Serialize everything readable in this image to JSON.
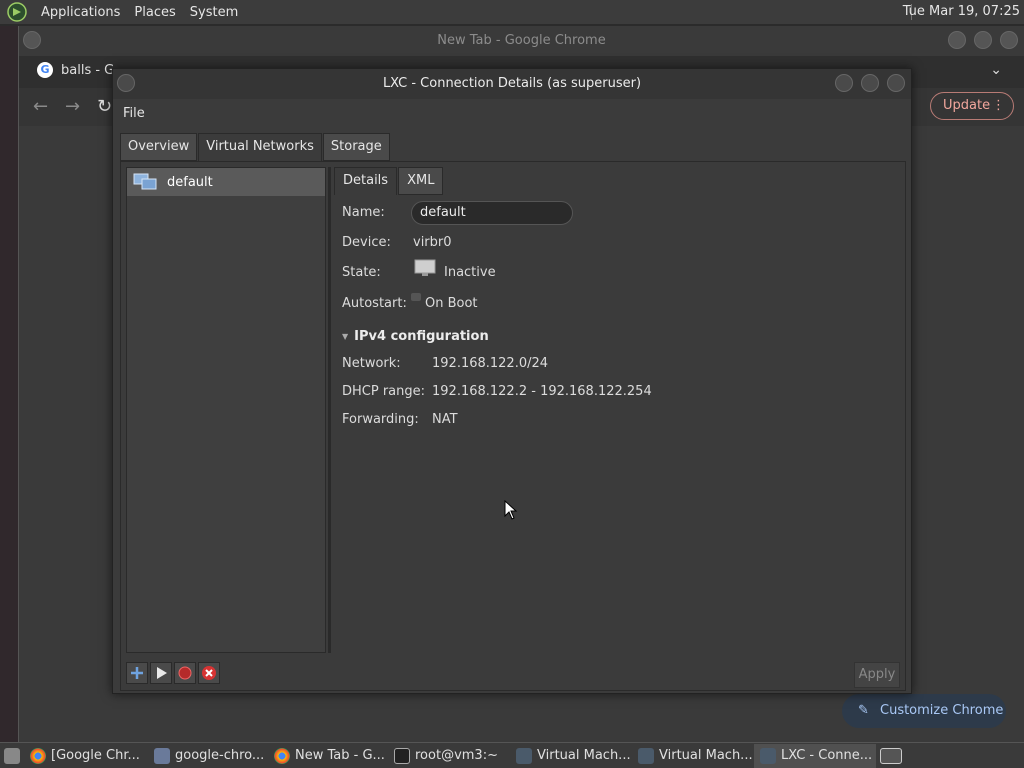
{
  "top_panel": {
    "menus": [
      "Applications",
      "Places",
      "System"
    ],
    "clock": "Tue Mar 19, 07:25"
  },
  "chrome": {
    "title": "New Tab - Google Chrome",
    "tab_label": "balls - G",
    "update_label": "Update",
    "customize_label": "Customize Chrome"
  },
  "dialog": {
    "title": "LXC - Connection Details (as superuser)",
    "menu_file": "File",
    "tabs": [
      "Overview",
      "Virtual Networks",
      "Storage"
    ],
    "active_tab": "Virtual Networks",
    "networks": [
      {
        "name": "default"
      }
    ],
    "subtabs": [
      "Details",
      "XML"
    ],
    "labels": {
      "name": "Name:",
      "device": "Device:",
      "state": "State:",
      "autostart": "Autostart:",
      "network": "Network:",
      "dhcp": "DHCP range:",
      "forwarding": "Forwarding:"
    },
    "values": {
      "name": "default",
      "device": "virbr0",
      "state": "Inactive",
      "autostart": "On Boot",
      "network": "192.168.122.0/24",
      "dhcp": "192.168.122.2 - 192.168.122.254",
      "forwarding": "NAT"
    },
    "section_title": "IPv4 configuration",
    "apply_label": "Apply"
  },
  "taskbar": {
    "items": [
      "[Google Chr...",
      "google-chro...",
      "New Tab - G...",
      "root@vm3:~",
      "Virtual Mach...",
      "Virtual Mach...",
      "LXC - Conne..."
    ]
  }
}
